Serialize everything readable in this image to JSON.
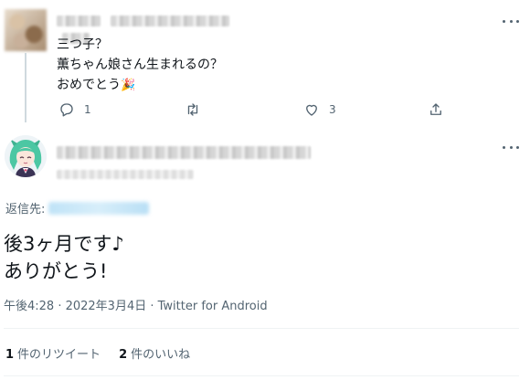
{
  "parent_tweet": {
    "text_lines": [
      "三つ子？",
      "薫ちゃん娘さん生まれるの？",
      "おめでとう"
    ],
    "celebration_icon": "party-popper-icon",
    "actions": {
      "reply_count": "1",
      "retweet_count": "",
      "like_count": "3"
    }
  },
  "main_tweet": {
    "reply_to_label": "返信先:",
    "text_lines": [
      "後3ヶ月です♪",
      "ありがとう!"
    ],
    "meta": "午後4:28 · 2022年3月4日 · Twitter for Android",
    "stats": {
      "retweets_count": "1",
      "retweets_label": "件のリツイート",
      "likes_count": "2",
      "likes_label": "件のいいね"
    }
  },
  "colors": {
    "text_primary": "#0f1419",
    "text_secondary": "#536471",
    "thread_line": "#cfd9de",
    "divider": "#eff3f4",
    "blurred_mention": "#bfe3f7"
  }
}
